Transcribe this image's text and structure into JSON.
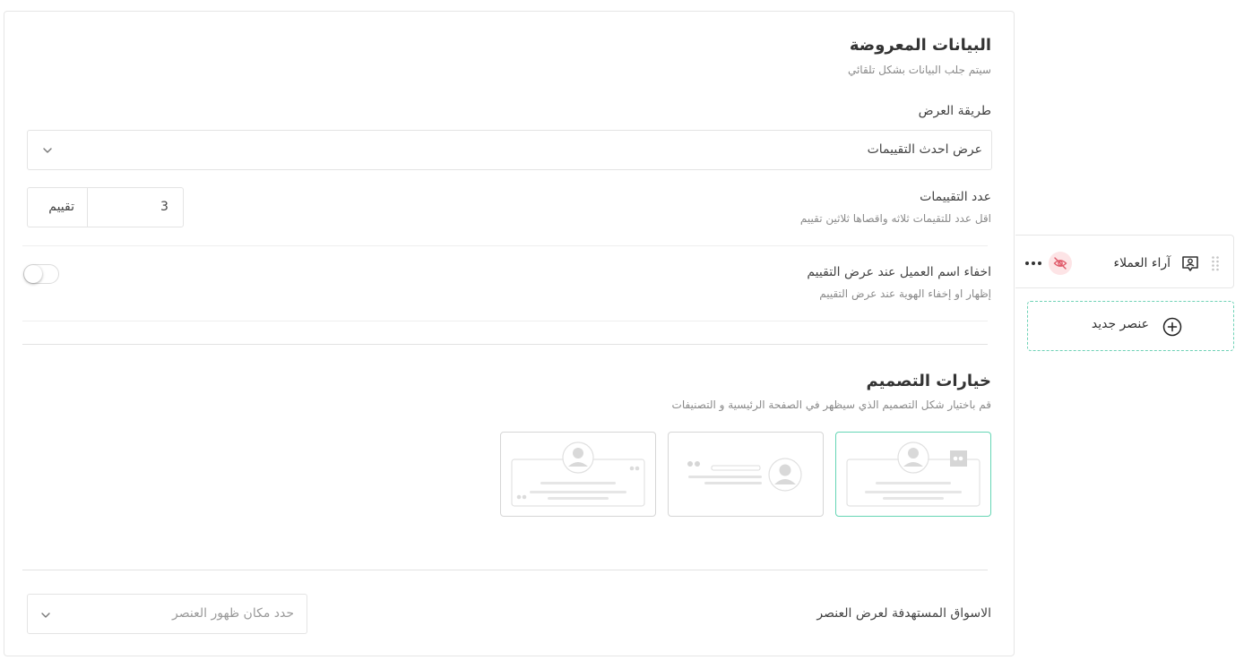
{
  "displayed_data": {
    "title": "البيانات المعروضة",
    "subtitle": "سيتم جلب البيانات بشكل تلقائي",
    "display_method_label": "طريقة العرض",
    "display_method_value": "عرض احدث التقييمات",
    "ratings_count_label": "عدد التقييمات",
    "ratings_count_hint": "اقل عدد للتقيمات ثلاثه واقصاها ثلاثين تقييم",
    "ratings_count_value": "3",
    "ratings_count_unit": "تقييم",
    "hide_name_label": "اخفاء اسم العميل عند عرض التقييم",
    "hide_name_hint": "إظهار او إخفاء الهوية عند عرض التقييم",
    "hide_name_enabled": false
  },
  "design_options": {
    "title": "خيارات التصميم",
    "subtitle": "قم باختيار شكل التصميم الذي سيظهر في الصفحة الرئيسية و التصنيفات",
    "selected_index": 0,
    "options": [
      "design-1",
      "design-2",
      "design-3"
    ]
  },
  "target_markets": {
    "label": "الاسواق المستهدفة لعرض العنصر",
    "placeholder": "حدد مكان ظهور العنصر"
  },
  "sidebar": {
    "item_label": "آراء العملاء",
    "item_icon": "review-icon",
    "visibility_icon": "eye-off-icon",
    "more_icon": "more-dots-icon",
    "new_element_label": "عنصر جديد"
  },
  "colors": {
    "accent": "#1fa88a",
    "accent_border": "#66d6b5",
    "danger_bg": "#fde4e6",
    "danger": "#e05a6a"
  }
}
